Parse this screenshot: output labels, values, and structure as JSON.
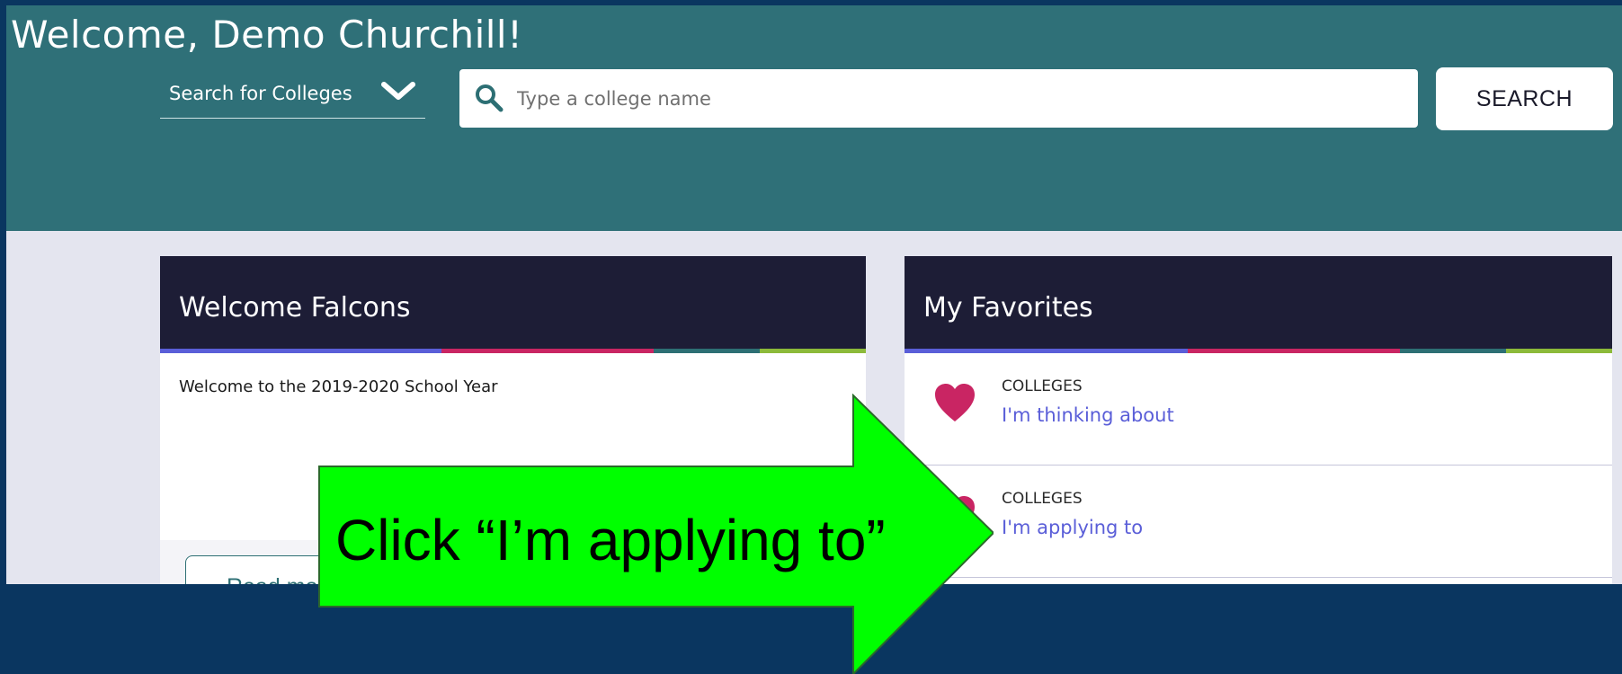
{
  "header": {
    "welcome_title": "Welcome, Demo Churchill!",
    "search_type_label": "Search for Colleges",
    "search_placeholder": "Type a college name",
    "search_button_label": "SEARCH"
  },
  "welcome_card": {
    "title": "Welcome Falcons",
    "body": "Welcome to the 2019-2020 School Year",
    "read_more_label": "Read more"
  },
  "favorites_card": {
    "title": "My Favorites",
    "items": [
      {
        "category": "COLLEGES",
        "label": "I'm thinking about"
      },
      {
        "category": "COLLEGES",
        "label": "I'm applying to"
      }
    ]
  },
  "callout": {
    "text": "Click “I’m applying to”"
  },
  "icons": {
    "search": "magnifier-icon",
    "dropdown": "chevron-down-icon",
    "favorite": "heart-icon"
  },
  "colors": {
    "topbar": "#2f7078",
    "card_header": "#1d1d36",
    "link": "#5a5ed8",
    "heart": "#c92563",
    "callout": "#00ff00",
    "outer_background": "#0a3660"
  }
}
